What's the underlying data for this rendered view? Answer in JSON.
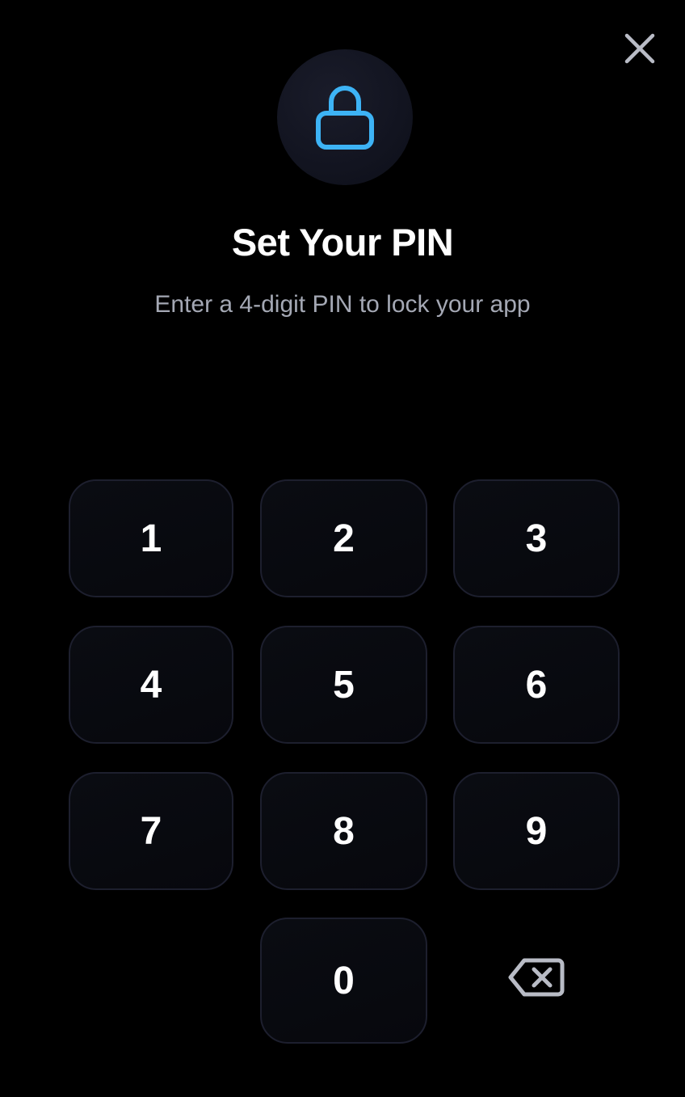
{
  "header": {
    "close_icon": "close-icon",
    "lock_icon": "lock-icon"
  },
  "content": {
    "title": "Set Your PIN",
    "subtitle": "Enter a 4-digit PIN to lock your app"
  },
  "keypad": {
    "keys": [
      "1",
      "2",
      "3",
      "4",
      "5",
      "6",
      "7",
      "8",
      "9",
      "0"
    ],
    "backspace_icon": "backspace-icon"
  },
  "colors": {
    "accent": "#3db3f5",
    "background": "#000000",
    "subtitle": "#a4a8b4",
    "key_border": "#1d1f2e"
  }
}
